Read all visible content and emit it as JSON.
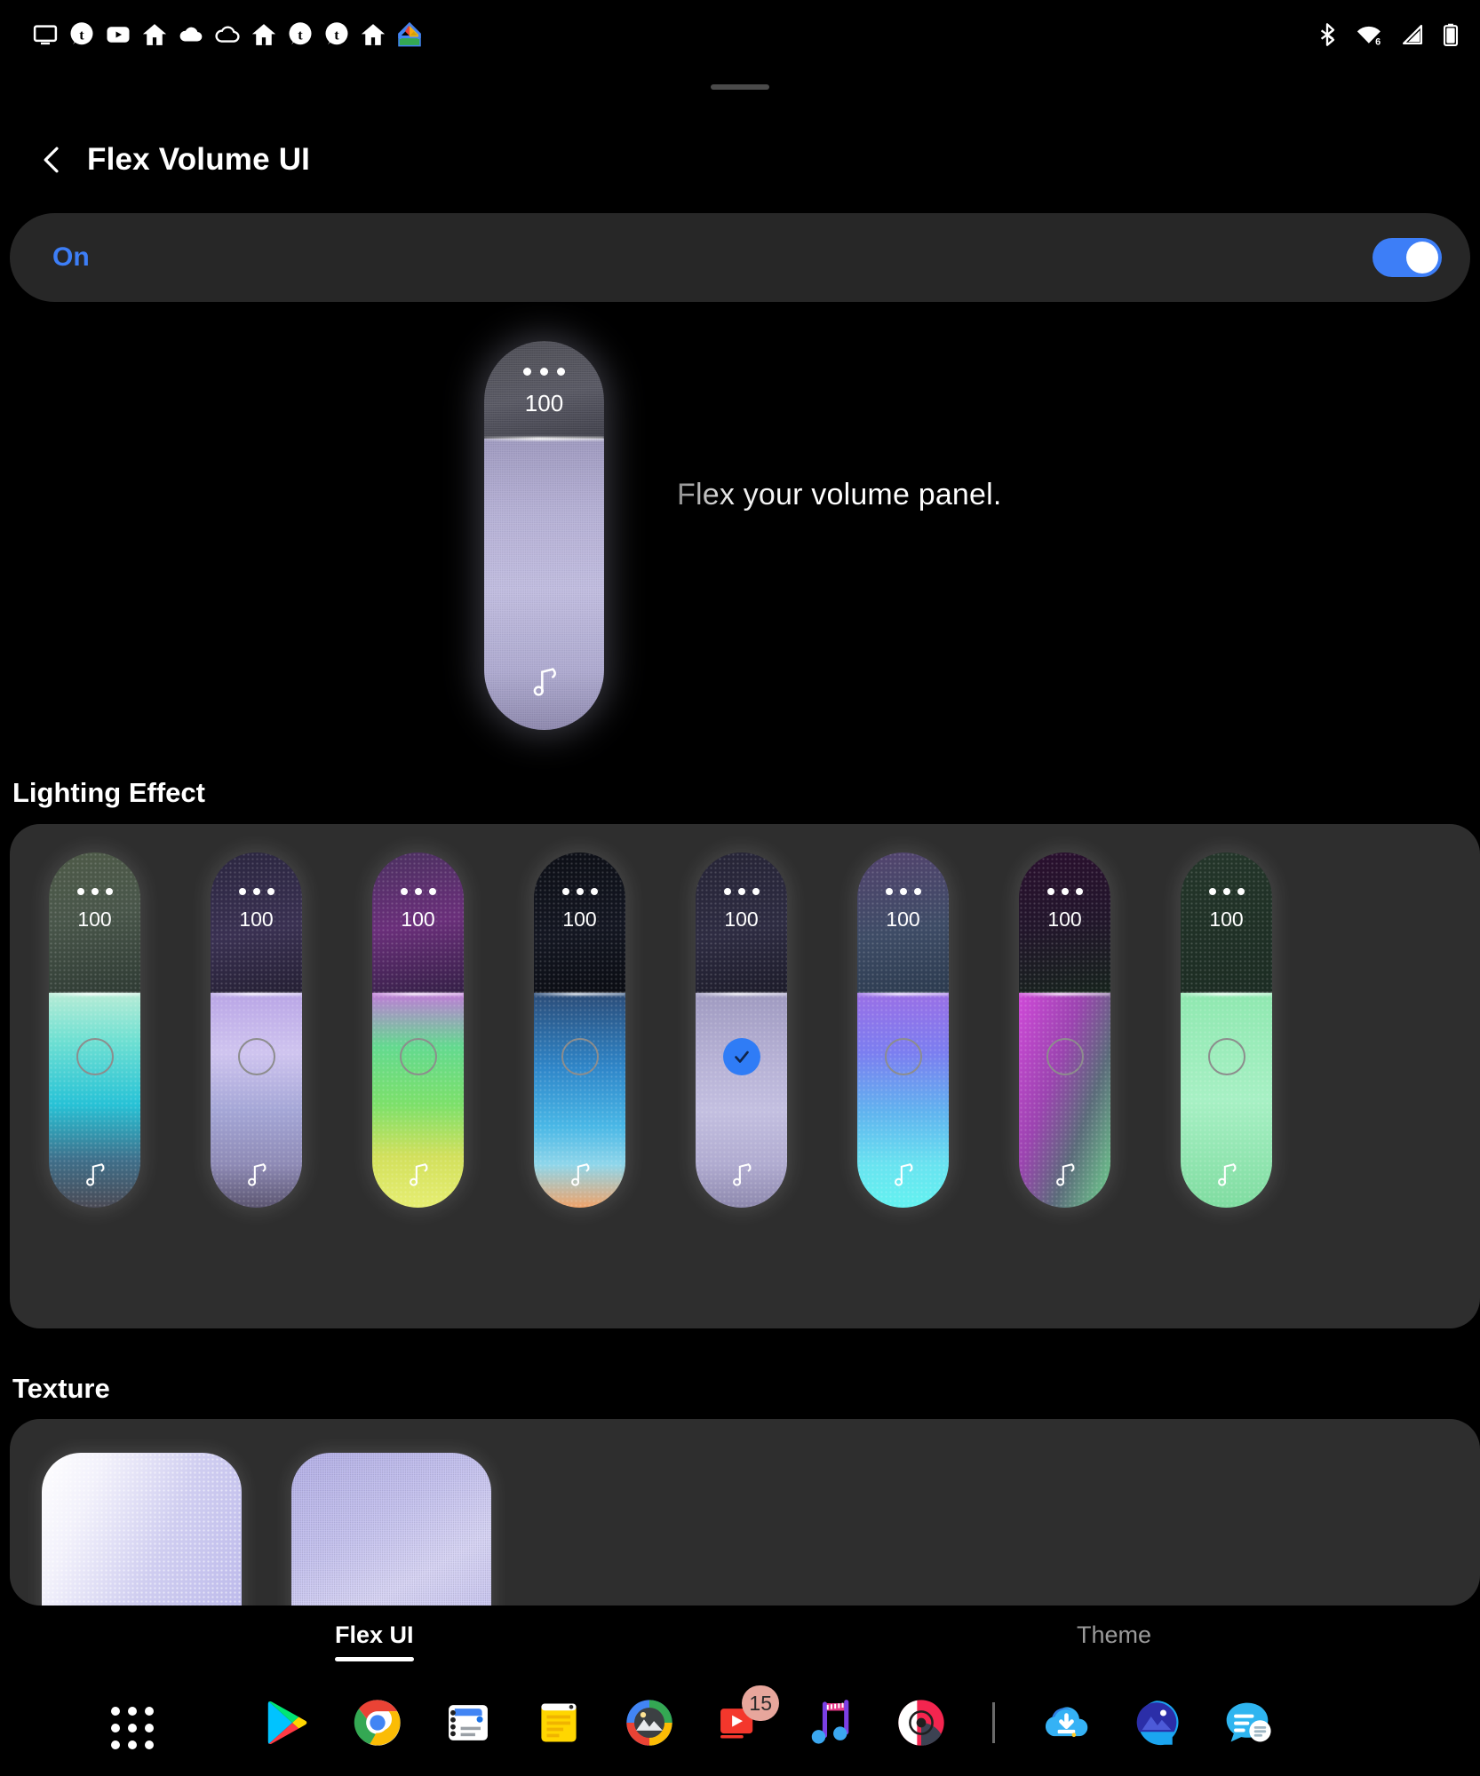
{
  "statusbar": {
    "left_icons": [
      "monitor-icon",
      "tumblr-icon",
      "youtube-icon",
      "home-icon",
      "cloud-icon",
      "cloud-outline-icon",
      "home-icon",
      "tumblr-icon",
      "tumblr-icon",
      "home-icon",
      "google-home-icon"
    ],
    "right_icons": [
      "bluetooth-icon",
      "wifi-6-icon",
      "cellular-signal-icon",
      "battery-icon"
    ]
  },
  "header": {
    "title": "Flex Volume UI",
    "back_label": "Back"
  },
  "toggle": {
    "label": "On",
    "state": "on",
    "accent": "#3d7ef7"
  },
  "preview": {
    "caption": "Flex your volume panel.",
    "value": "100",
    "menu_icon": "more-dots-icon",
    "media_icon": "music-note-icon"
  },
  "lighting": {
    "title": "Lighting Effect",
    "selected_index": 4,
    "items": [
      {
        "name": "green-teal",
        "value": "100",
        "top": "linear-gradient(170deg,#4e5a48 0%,#49564a 45%,#2e3a33 100%)",
        "body": "linear-gradient(180deg,#b7ecd6 0%,#6fe0d2 22%,#27c2d6 52%,#3f6f8a 78%,#4a4a55 100%)"
      },
      {
        "name": "violet-haze",
        "value": "100",
        "top": "linear-gradient(170deg,#2b2640 0%,#3a3152 55%,#241f33 100%)",
        "body": "linear-gradient(180deg,#b9a5e6 0%,#cfc4ef 28%,#a4a6d6 55%,#8e8ab5 80%,#5b5570 100%)"
      },
      {
        "name": "rainbow-lime",
        "value": "100",
        "top": "linear-gradient(170deg,#4b3060 0%,#6a2f7a 50%,#331f45 100%)",
        "body": "linear-gradient(180deg,#c07bd8 0%,#63d98f 25%,#7ce06a 52%,#d2e05c 76%,#e6ee72 100%)"
      },
      {
        "name": "blue-sunset",
        "value": "100",
        "top": "linear-gradient(170deg,#0d0f16 0%,#141722 55%,#0a0c12 100%)",
        "body": "linear-gradient(180deg,#2b4c78 0%,#2f86c9 35%,#49b7e6 62%,#8fd6ea 80%,#efa36a 100%)"
      },
      {
        "name": "lavender-mist",
        "value": "100",
        "top": "linear-gradient(170deg,#262436 0%,#2e2c42 55%,#1c1b29 100%)",
        "body": "linear-gradient(180deg,#9f9ac0 0%,#b5b0d4 30%,#c3bfe0 55%,#b0abd0 80%,#8d88ad 100%)"
      },
      {
        "name": "purple-cyan",
        "value": "100",
        "top": "linear-gradient(170deg,#53436e 0%,#3e4c66 55%,#2b3a4e 100%)",
        "body": "linear-gradient(180deg,#9a6fe6 0%,#7b7ef0 28%,#60b4ef 56%,#69e3f0 80%,#63f2f0 100%)"
      },
      {
        "name": "magenta-green",
        "value": "100",
        "top": "linear-gradient(170deg,#2a0f2e 0%,#22162b 50%,#16231c 100%)",
        "body": "linear-gradient(110deg,#cf49d8 0%,#9b44b0 38%,#5b6b7a 66%,#6fd18e 100%)"
      },
      {
        "name": "mint-glow",
        "value": "100",
        "top": "linear-gradient(170deg,#24362a 0%,#1c2c23 100%)",
        "body": "linear-gradient(180deg,#8fe8b0 0%,#a7f0c4 50%,#7fdca0 100%)"
      }
    ]
  },
  "texture": {
    "title": "Texture",
    "items": [
      {
        "name": "halftone-dots",
        "gradient": "linear-gradient(115deg,#ffffff 0%,#f2f1fb 22%,#cfcdf0 55%,#b9b6ea 100%)"
      },
      {
        "name": "fine-grain",
        "gradient": "linear-gradient(150deg,#b2aee6 0%,#c3c0ee 35%,#d6d3f4 60%,#bcb9eb 100%)"
      }
    ]
  },
  "tabs": {
    "active_index": 0,
    "items": [
      {
        "label": "Flex UI",
        "name": "tab-flex-ui"
      },
      {
        "label": "Theme",
        "name": "tab-theme"
      }
    ]
  },
  "dock": {
    "app_drawer": "app-drawer-icon",
    "apps": [
      {
        "name": "play-store-icon"
      },
      {
        "name": "chrome-icon"
      },
      {
        "name": "files-icon"
      },
      {
        "name": "keep-notes-icon"
      },
      {
        "name": "photos-icon"
      },
      {
        "name": "video-player-icon",
        "badge": "15"
      },
      {
        "name": "music-notes-icon"
      },
      {
        "name": "music-disc-icon"
      },
      {
        "name": "divider"
      },
      {
        "name": "cloud-download-icon"
      },
      {
        "name": "gallery-icon"
      },
      {
        "name": "messages-icon"
      }
    ]
  }
}
